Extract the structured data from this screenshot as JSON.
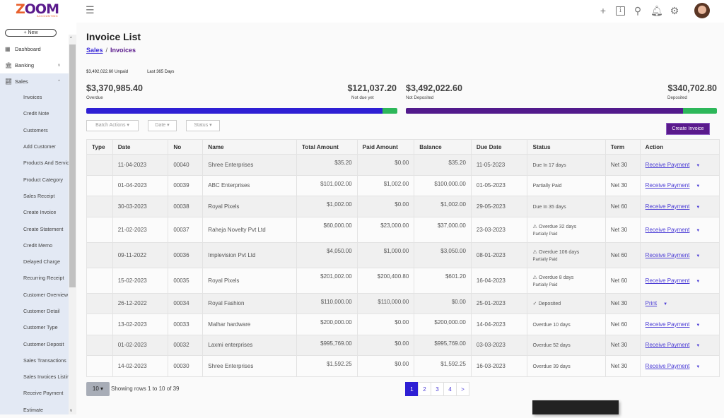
{
  "app": {
    "logo_text": "ZOOM",
    "logo_sub": "ACCOUNTING"
  },
  "topbar": {
    "icons": [
      "plus-icon",
      "info-icon",
      "search-icon",
      "bell-icon",
      "gear-icon",
      "avatar"
    ]
  },
  "sidebar": {
    "new_label": "+ New",
    "top_items": [
      {
        "label": "Dashboard",
        "icon": "grid-icon"
      },
      {
        "label": "Banking",
        "icon": "bank-icon",
        "chevron": "v"
      },
      {
        "label": "Sales",
        "icon": "chart-icon",
        "chevron": "^"
      }
    ],
    "sub_items": [
      "Invoices",
      "Credit Note",
      "Customers",
      "Add Customer",
      "Products And Services",
      "Product Category",
      "Sales Receipt",
      "Create Invoice",
      "Create Statement",
      "Credit Memo",
      "Delayed Charge",
      "Recurring Receipt",
      "Customer Overview",
      "Customer Detail",
      "Customer Type",
      "Customer Deposit",
      "Sales Transactions",
      "Sales Invoices Listing",
      "Receive Payment",
      "Estimate"
    ]
  },
  "page": {
    "title": "Invoice List",
    "breadcrumb": {
      "parent": "Sales",
      "separator": "/",
      "current": "Invoices"
    }
  },
  "summary": {
    "unpaid": "$3,492,022.60 Unpaid",
    "period": "Last 365 Days",
    "overdue_amount": "$3,370,985.40",
    "overdue_label": "Overdue",
    "not_due_amount": "$121,037.20",
    "not_due_label": "Not due yet",
    "not_deposited_amount": "$3,492,022.60",
    "not_deposited_label": "Not Deposited",
    "deposited_amount": "$340,702.80",
    "deposited_label": "Deposited",
    "bar1_fraction": 0.953,
    "bar2_fraction": 0.89,
    "colors": {
      "overdue": "#2e1fd4",
      "not_due": "#2db75a",
      "not_deposited": "#521a8c",
      "deposited": "#2db75a"
    }
  },
  "filters": {
    "batch": "Batch Actions ▾",
    "date": "Date ▾",
    "status": "Status ▾",
    "create": "Create Invoice"
  },
  "table": {
    "headers": [
      "Type",
      "Date",
      "No",
      "Name",
      "Total Amount",
      "Paid Amount",
      "Balance",
      "Due Date",
      "Status",
      "Term",
      "Action"
    ],
    "rows": [
      {
        "type": "",
        "date": "11-04-2023",
        "no": "00040",
        "name": "Shree Enterprises",
        "total": "$35.20",
        "paid": "$0.00",
        "balance": "$35.20",
        "due": "11-05-2023",
        "status": "Due In 17 days",
        "status_icon": "",
        "status_sub": "",
        "term": "Net 30",
        "action": "Receive Payment"
      },
      {
        "type": "",
        "date": "01-04-2023",
        "no": "00039",
        "name": "ABC Enterprises",
        "total": "$101,002.00",
        "paid": "$1,002.00",
        "balance": "$100,000.00",
        "due": "01-05-2023",
        "status": "Partially Paid",
        "status_icon": "",
        "status_sub": "",
        "term": "Net 30",
        "action": "Receive Payment"
      },
      {
        "type": "",
        "date": "30-03-2023",
        "no": "00038",
        "name": "Royal Pixels",
        "total": "$1,002.00",
        "paid": "$0.00",
        "balance": "$1,002.00",
        "due": "29-05-2023",
        "status": "Due In 35 days",
        "status_icon": "",
        "status_sub": "",
        "term": "Net 60",
        "action": "Receive Payment"
      },
      {
        "type": "",
        "date": "21-02-2023",
        "no": "00037",
        "name": "Raheja Novelty Pvt Ltd",
        "total": "$60,000.00",
        "paid": "$23,000.00",
        "balance": "$37,000.00",
        "due": "23-03-2023",
        "status": "Overdue 32 days",
        "status_icon": "⚠",
        "status_sub": "Partially Paid",
        "term": "Net 30",
        "action": "Receive Payment"
      },
      {
        "type": "",
        "date": "09-11-2022",
        "no": "00036",
        "name": "Implevision Pvt Ltd",
        "total": "$4,050.00",
        "paid": "$1,000.00",
        "balance": "$3,050.00",
        "due": "08-01-2023",
        "status": "Overdue 106 days",
        "status_icon": "⚠",
        "status_sub": "Partially Paid",
        "term": "Net 60",
        "action": "Receive Payment"
      },
      {
        "type": "",
        "date": "15-02-2023",
        "no": "00035",
        "name": "Royal Pixels",
        "total": "$201,002.00",
        "paid": "$200,400.80",
        "balance": "$601.20",
        "due": "16-04-2023",
        "status": "Overdue 8 days",
        "status_icon": "⚠",
        "status_sub": "Partially Paid",
        "term": "Net 60",
        "action": "Receive Payment"
      },
      {
        "type": "",
        "date": "26-12-2022",
        "no": "00034",
        "name": "Royal Fashion",
        "total": "$110,000.00",
        "paid": "$110,000.00",
        "balance": "$0.00",
        "due": "25-01-2023",
        "status": "Deposited",
        "status_icon": "✓",
        "status_sub": "",
        "term": "Net 30",
        "action": "Print"
      },
      {
        "type": "",
        "date": "13-02-2023",
        "no": "00033",
        "name": "Malhar hardware",
        "total": "$200,000.00",
        "paid": "$0.00",
        "balance": "$200,000.00",
        "due": "14-04-2023",
        "status": "Overdue 10 days",
        "status_icon": "",
        "status_sub": "",
        "term": "Net 60",
        "action": "Receive Payment"
      },
      {
        "type": "",
        "date": "01-02-2023",
        "no": "00032",
        "name": "Laxmi enterprises",
        "total": "$995,769.00",
        "paid": "$0.00",
        "balance": "$995,769.00",
        "due": "03-03-2023",
        "status": "Overdue 52 days",
        "status_icon": "",
        "status_sub": "",
        "term": "Net 30",
        "action": "Receive Payment"
      },
      {
        "type": "",
        "date": "14-02-2023",
        "no": "00030",
        "name": "Shree Enterprises",
        "total": "$1,592.25",
        "paid": "$0.00",
        "balance": "$1,592.25",
        "due": "16-03-2023",
        "status": "Overdue 39 days",
        "status_icon": "",
        "status_sub": "",
        "term": "Net 30",
        "action": "Receive Payment"
      }
    ]
  },
  "pager": {
    "size": "10 ▾",
    "showing": "Showing rows 1 to 10 of 39",
    "pages": [
      "1",
      "2",
      "3",
      "4",
      ">"
    ],
    "current": "1"
  }
}
